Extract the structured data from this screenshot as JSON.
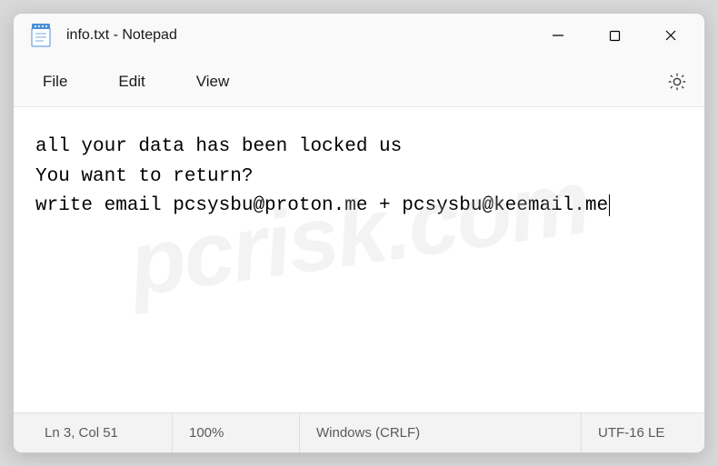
{
  "titlebar": {
    "title": "info.txt - Notepad"
  },
  "menu": {
    "file": "File",
    "edit": "Edit",
    "view": "View"
  },
  "editor": {
    "content": "all your data has been locked us\nYou want to return?\nwrite email pcsysbu@proton.me + pcsysbu@keemail.me"
  },
  "statusbar": {
    "position": "Ln 3, Col 51",
    "zoom": "100%",
    "lineending": "Windows (CRLF)",
    "encoding": "UTF-16 LE"
  },
  "watermark": "pcrisk.com"
}
